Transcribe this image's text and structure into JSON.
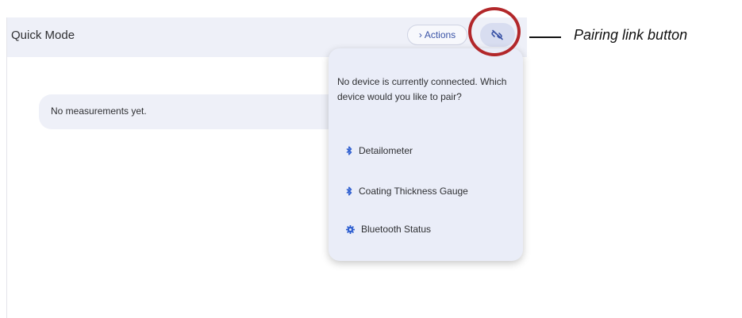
{
  "header": {
    "title": "Quick Mode",
    "actions_label": "Actions",
    "actions_icon": "chevron-right-icon",
    "pair_icon": "link-off-icon"
  },
  "main": {
    "empty_message": "No measurements yet."
  },
  "pairing_popover": {
    "prompt": "No device is currently connected. Which device would you like to pair?",
    "items": [
      {
        "label": "Detailometer",
        "icon": "bluetooth-icon"
      },
      {
        "label": "Coating Thickness Gauge",
        "icon": "bluetooth-icon"
      },
      {
        "label": "Bluetooth Status",
        "icon": "gear-icon"
      }
    ]
  },
  "annotation": {
    "label": "Pairing link button",
    "highlight_color": "#b2272a"
  },
  "colors": {
    "accent": "#3a53a6",
    "header_bg": "#eef0f8",
    "popover_bg": "#eaedf8",
    "bluetooth": "#2f5fd0"
  }
}
